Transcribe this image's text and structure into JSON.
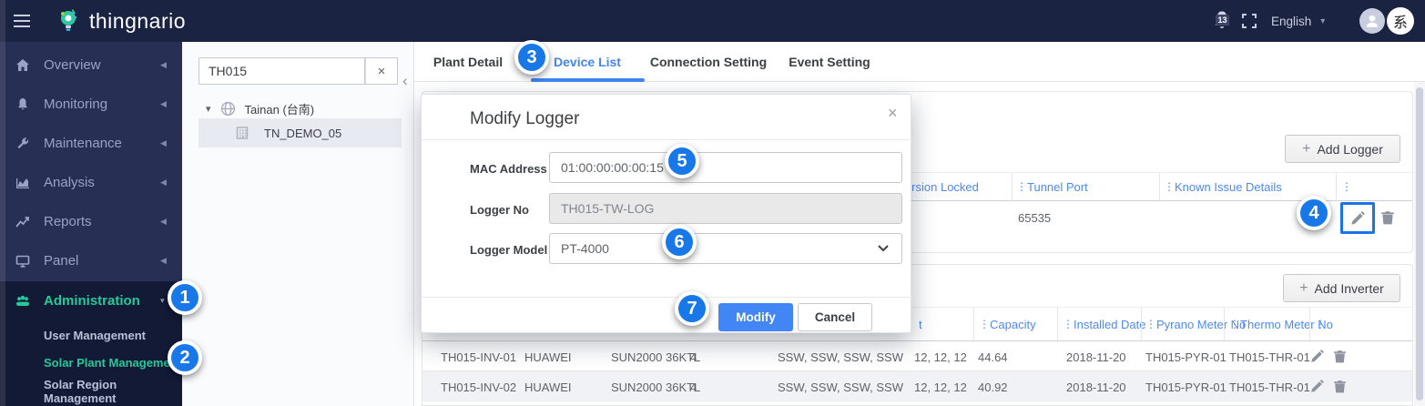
{
  "header": {
    "brand": "thingnario",
    "notification_count": "13",
    "language": "English",
    "profile_initial": "系"
  },
  "sidebar": {
    "items": [
      {
        "label": "Overview"
      },
      {
        "label": "Monitoring"
      },
      {
        "label": "Maintenance"
      },
      {
        "label": "Analysis"
      },
      {
        "label": "Reports"
      },
      {
        "label": "Panel"
      }
    ],
    "admin": {
      "label": "Administration",
      "subitems": [
        {
          "label": "User Management"
        },
        {
          "label": "Solar Plant Management"
        },
        {
          "label": "Solar Region Management"
        }
      ],
      "active_subitem": "Solar Plant Management"
    }
  },
  "tree": {
    "search_value": "TH015",
    "region_label": "Tainan (台南)",
    "plant_label": "TN_DEMO_05"
  },
  "tabs": {
    "items": [
      {
        "label": "Plant Detail"
      },
      {
        "label": "Device List"
      },
      {
        "label": "Connection Setting"
      },
      {
        "label": "Event Setting"
      }
    ],
    "active": "Device List"
  },
  "logger": {
    "add_button": "Add Logger",
    "columns": {
      "version_locked": "Version Locked",
      "tunnel_port": "Tunnel Port",
      "known_issue": "Known Issue Details"
    },
    "row": {
      "tunnel_port": "65535"
    }
  },
  "inverter": {
    "add_button": "Add Inverter",
    "columns": {
      "fragment": "t",
      "capacity": "Capacity",
      "installed_date": "Installed Date",
      "pyrano": "Pyrano Meter No",
      "thermo": "Thermo Meter No"
    },
    "rows": [
      {
        "no": "TH015-INV-01",
        "brand": "HUAWEI",
        "model": "SUN2000 36KTL",
        "count": "4",
        "directions": "SSW, SSW, SSW, SSW",
        "tilts": "12, 12, 12",
        "capacity": "44.64",
        "installed": "2018-11-20",
        "pyrano": "TH015-PYR-01",
        "thermo": "TH015-THR-01"
      },
      {
        "no": "TH015-INV-02",
        "brand": "HUAWEI",
        "model": "SUN2000 36KTL",
        "count": "4",
        "directions": "SSW, SSW, SSW, SSW",
        "tilts": "12, 12, 12",
        "capacity": "40.92",
        "installed": "2018-11-20",
        "pyrano": "TH015-PYR-01",
        "thermo": "TH015-THR-01"
      }
    ]
  },
  "modal": {
    "title": "Modify Logger",
    "mac_label": "MAC Address",
    "mac_value": "01:00:00:00:00:15",
    "logger_no_label": "Logger No",
    "logger_no_value": "TH015-TW-LOG",
    "model_label": "Logger Model Name",
    "model_value": "PT-4000",
    "modify_button": "Modify",
    "cancel_button": "Cancel"
  },
  "annotations": {
    "steps": [
      {
        "n": "1"
      },
      {
        "n": "2"
      },
      {
        "n": "3"
      },
      {
        "n": "4"
      },
      {
        "n": "5"
      },
      {
        "n": "6"
      },
      {
        "n": "7"
      }
    ]
  },
  "glyphs": {
    "kebab": "⋮",
    "caret_left": "◀",
    "caret_down": "▾",
    "close": "×",
    "clear": "×",
    "collapse": "‹",
    "plus": "+"
  },
  "colors": {
    "accent_green": "#25c99a",
    "accent_blue": "#4285f4",
    "badge_blue": "#1878e8",
    "navy": "#1b2342"
  }
}
